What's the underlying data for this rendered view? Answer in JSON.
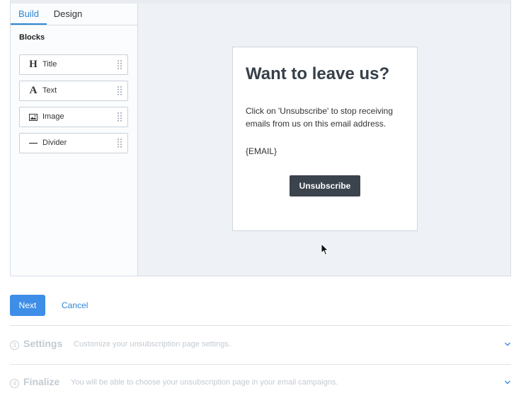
{
  "tabs": {
    "build": "Build",
    "design": "Design"
  },
  "sidebar": {
    "blocks_title": "Blocks",
    "blocks": [
      {
        "label": "Title",
        "icon": "title-heading-icon",
        "glyph": "H"
      },
      {
        "label": "Text",
        "icon": "text-letter-icon",
        "glyph": "A"
      },
      {
        "label": "Image",
        "icon": "image-icon"
      },
      {
        "label": "Divider",
        "icon": "divider-line-icon"
      }
    ]
  },
  "preview": {
    "heading": "Want to leave us?",
    "message": "Click on 'Unsubscribe' to stop receiving emails from us on this email address.",
    "email_placeholder": "{EMAIL}",
    "button_label": "Unsubscribe"
  },
  "actions": {
    "next": "Next",
    "cancel": "Cancel"
  },
  "steps": [
    {
      "number": "3",
      "title": "Settings",
      "description": "Customize your unsubscription page settings."
    },
    {
      "number": "4",
      "title": "Finalize",
      "description": "You will be able to choose your unsubscription page in your email campaigns."
    }
  ],
  "colors": {
    "accent": "#3e8ee8",
    "link": "#2f86d6",
    "dark_button": "#3b434d",
    "disabled_text": "#c3cad2"
  }
}
